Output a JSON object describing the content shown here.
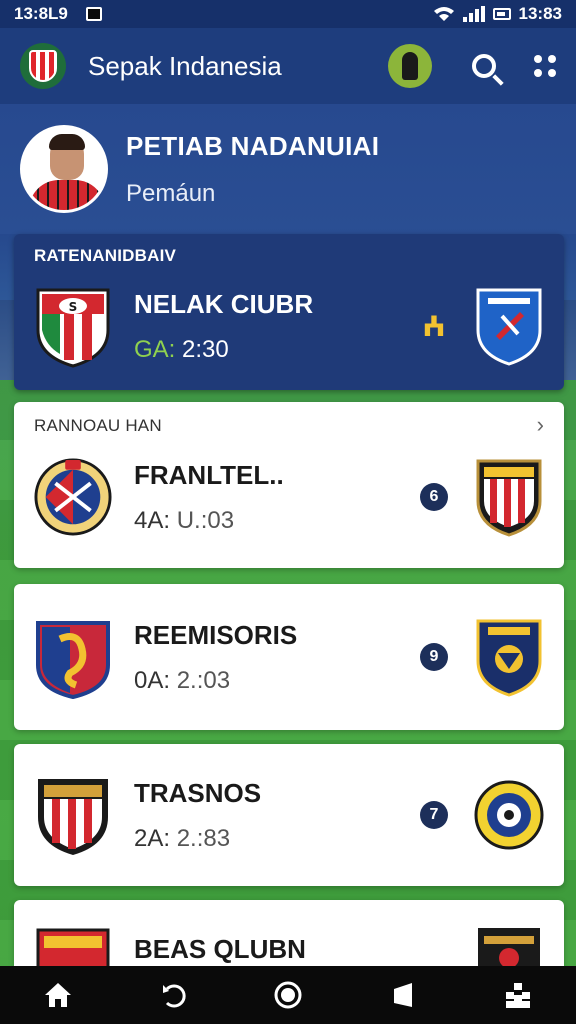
{
  "status_bar": {
    "time": "13:8L9",
    "right_time": "13:83"
  },
  "app_bar": {
    "title": "Sepak Indanesia"
  },
  "profile": {
    "name": "PETIAB NADANUIAI",
    "role": "Pemáun"
  },
  "featured": {
    "section_label": "RATENANIDBAIV",
    "team": "NELAK CIUBR",
    "time_prefix": "GA:",
    "time": "2:30",
    "badge": "ⵄ"
  },
  "matches": {
    "section_label": "RANNOAU HAN",
    "items": [
      {
        "team": "FRANLTEL..",
        "time_prefix": "4A:",
        "time": "U.:03",
        "badge": "6"
      },
      {
        "team": "REEMISORIS",
        "time_prefix": "0A:",
        "time": "2.:03",
        "badge": "9"
      },
      {
        "team": "TRASNOS",
        "time_prefix": "2A:",
        "time": "2.:83",
        "badge": "7"
      },
      {
        "team": "BEAS QLUBN",
        "time_prefix": "",
        "time": "",
        "badge": ""
      }
    ]
  },
  "nav": [
    "home-icon",
    "back-icon",
    "circle-home-icon",
    "recents-icon",
    "apps-grid-icon"
  ]
}
